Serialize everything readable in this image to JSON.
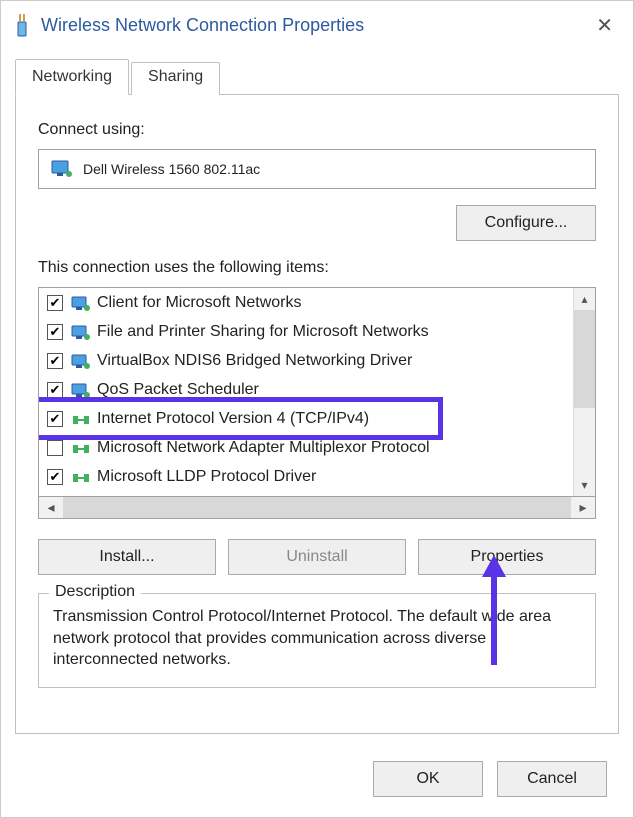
{
  "window": {
    "title": "Wireless Network Connection Properties",
    "icon": "usb-adapter-icon"
  },
  "tabs": {
    "networking": "Networking",
    "sharing": "Sharing",
    "active": "networking"
  },
  "connect_using": {
    "label": "Connect using:",
    "adapter_name": "Dell Wireless 1560 802.11ac"
  },
  "configure_button": "Configure...",
  "items_label": "This connection uses the following items:",
  "items": [
    {
      "checked": true,
      "icon": "net-client",
      "label": "Client for Microsoft Networks"
    },
    {
      "checked": true,
      "icon": "net-service",
      "label": "File and Printer Sharing for Microsoft Networks"
    },
    {
      "checked": true,
      "icon": "net-service",
      "label": "VirtualBox NDIS6 Bridged Networking Driver"
    },
    {
      "checked": true,
      "icon": "net-service",
      "label": "QoS Packet Scheduler"
    },
    {
      "checked": true,
      "icon": "net-protocol",
      "label": "Internet Protocol Version 4 (TCP/IPv4)"
    },
    {
      "checked": false,
      "icon": "net-protocol",
      "label": "Microsoft Network Adapter Multiplexor Protocol"
    },
    {
      "checked": true,
      "icon": "net-protocol",
      "label": "Microsoft LLDP Protocol Driver"
    }
  ],
  "buttons": {
    "install": "Install...",
    "uninstall": "Uninstall",
    "properties": "Properties"
  },
  "description": {
    "title": "Description",
    "text": "Transmission Control Protocol/Internet Protocol. The default wide area network protocol that provides communication across diverse interconnected networks."
  },
  "footer": {
    "ok": "OK",
    "cancel": "Cancel"
  },
  "annotation": {
    "highlight_index": 4,
    "arrow_target": "properties"
  },
  "colors": {
    "highlight": "#5a33e6",
    "title": "#2c5aa0"
  }
}
